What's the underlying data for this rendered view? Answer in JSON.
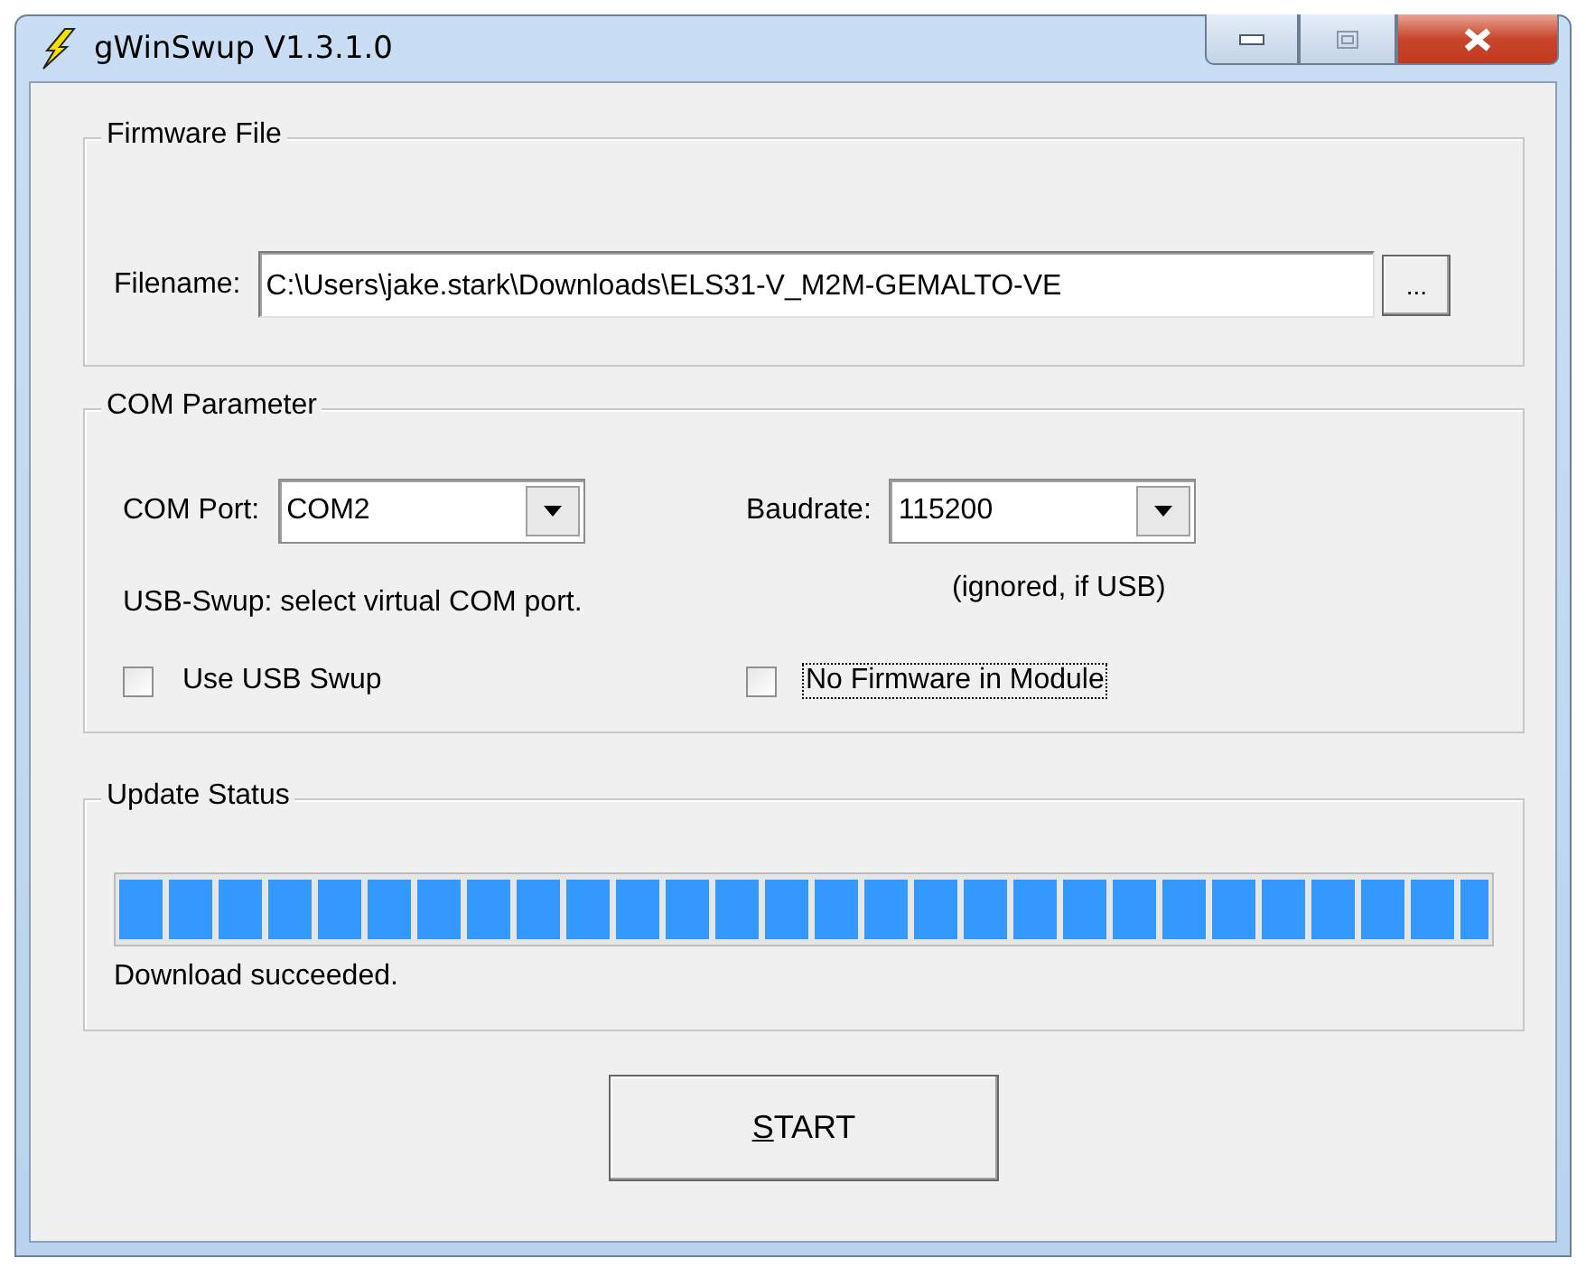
{
  "window": {
    "title": "gWinSwup V1.3.1.0"
  },
  "firmware_file": {
    "legend": "Firmware File",
    "filename_label": "Filename:",
    "filename_value": "C:\\Users\\jake.stark\\Downloads\\ELS31-V_M2M-GEMALTO-VE",
    "browse_button": "..."
  },
  "com_parameter": {
    "legend": "COM Parameter",
    "com_port_label": "COM Port:",
    "com_port_value": "COM2",
    "baudrate_label": "Baudrate:",
    "baudrate_value": "115200",
    "usb_hint": "USB-Swup: select virtual COM port.",
    "baud_hint": "(ignored, if USB)",
    "checkboxes": [
      {
        "label": "Use USB Swup",
        "checked": false,
        "focused": false
      },
      {
        "label": "No Firmware in Module",
        "checked": false,
        "focused": true
      }
    ]
  },
  "update_status": {
    "legend": "Update Status",
    "progress": {
      "level": 1.0
    },
    "message": "Download succeeded."
  },
  "buttons": [
    {
      "label": "START"
    }
  ]
}
